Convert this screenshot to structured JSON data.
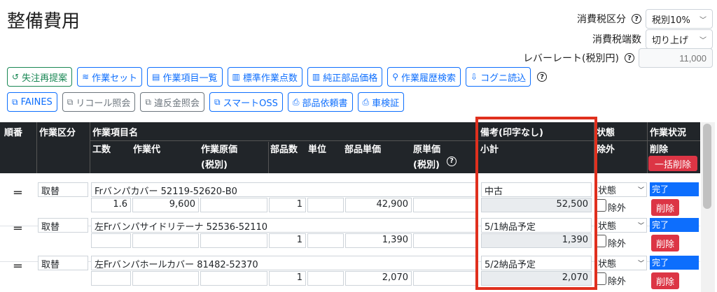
{
  "page_title": "整備費用",
  "tax": {
    "category_label": "消費税区分",
    "category_value": "税別10%",
    "rounding_label": "消費税端数",
    "rounding_value": "切り上げ",
    "rate_label": "レバーレート(税別円)",
    "rate_placeholder": "11,000"
  },
  "toolbar1": [
    {
      "label": "失注再提案",
      "icon": "redo-icon"
    },
    {
      "label": "作業セット",
      "icon": "layers-icon"
    },
    {
      "label": "作業項目一覧",
      "icon": "list-icon"
    },
    {
      "label": "標準作業点数",
      "icon": "book-icon"
    },
    {
      "label": "純正部品価格",
      "icon": "book-icon"
    },
    {
      "label": "作業履歴検索",
      "icon": "search-icon"
    },
    {
      "label": "コグニ読込",
      "icon": "file-import-icon"
    }
  ],
  "toolbar2": [
    {
      "label": "FAINES",
      "icon": "external-link-icon"
    },
    {
      "label": "リコール照会",
      "icon": "external-link-icon"
    },
    {
      "label": "違反金照会",
      "icon": "external-link-icon"
    },
    {
      "label": "スマートOSS",
      "icon": "external-link-icon"
    },
    {
      "label": "部品依頼書",
      "icon": "pdf-icon"
    },
    {
      "label": "車検証",
      "icon": "pdf-icon"
    }
  ],
  "table_header": {
    "order": "順番",
    "work_category": "作業区分",
    "work_item": "作業項目名",
    "hours": "工数",
    "labor_fee": "作業代",
    "work_cost": "作業原価",
    "work_cost_sub": "(税別)",
    "parts_qty": "部品数",
    "unit": "単位",
    "parts_unit_price": "部品単価",
    "cost_unit_price": "原単価",
    "cost_unit_price_sub": "(税別)",
    "notes": "備考(印字なし)",
    "subtotal": "小計",
    "state": "状態",
    "exclude": "除外",
    "work_status": "作業状況",
    "delete": "削除",
    "bulk_delete": "一括削除"
  },
  "rows": [
    {
      "category": "取替",
      "item": "Frバンパカバー 52119-52620-B0",
      "hours": "1.6",
      "labor": "9,600",
      "qty": "1",
      "unit_price": "42,900",
      "notes": "中古",
      "subtotal": "52,500",
      "state": "状態",
      "exclude_label": "除外",
      "status": "完了",
      "delete_label": "削除"
    },
    {
      "category": "取替",
      "item": "左Frバンパサイドリテーナ 52536-52110",
      "hours": "",
      "labor": "",
      "qty": "1",
      "unit_price": "1,390",
      "notes": "5/1納品予定",
      "subtotal": "1,390",
      "state": "状態",
      "exclude_label": "除外",
      "status": "完了",
      "delete_label": "削除"
    },
    {
      "category": "取替",
      "item": "左Frバンパホールカバー 81482-52370",
      "hours": "",
      "labor": "",
      "qty": "1",
      "unit_price": "2,070",
      "notes": "5/2納品予定",
      "subtotal": "2,070",
      "state": "状態",
      "exclude_label": "除外",
      "status": "完了",
      "delete_label": "削除"
    }
  ],
  "colors": {
    "primary": "#0d6efd",
    "danger": "#dc3545",
    "success": "#198754",
    "highlight": "#e0301e",
    "header_bg": "#212529"
  }
}
